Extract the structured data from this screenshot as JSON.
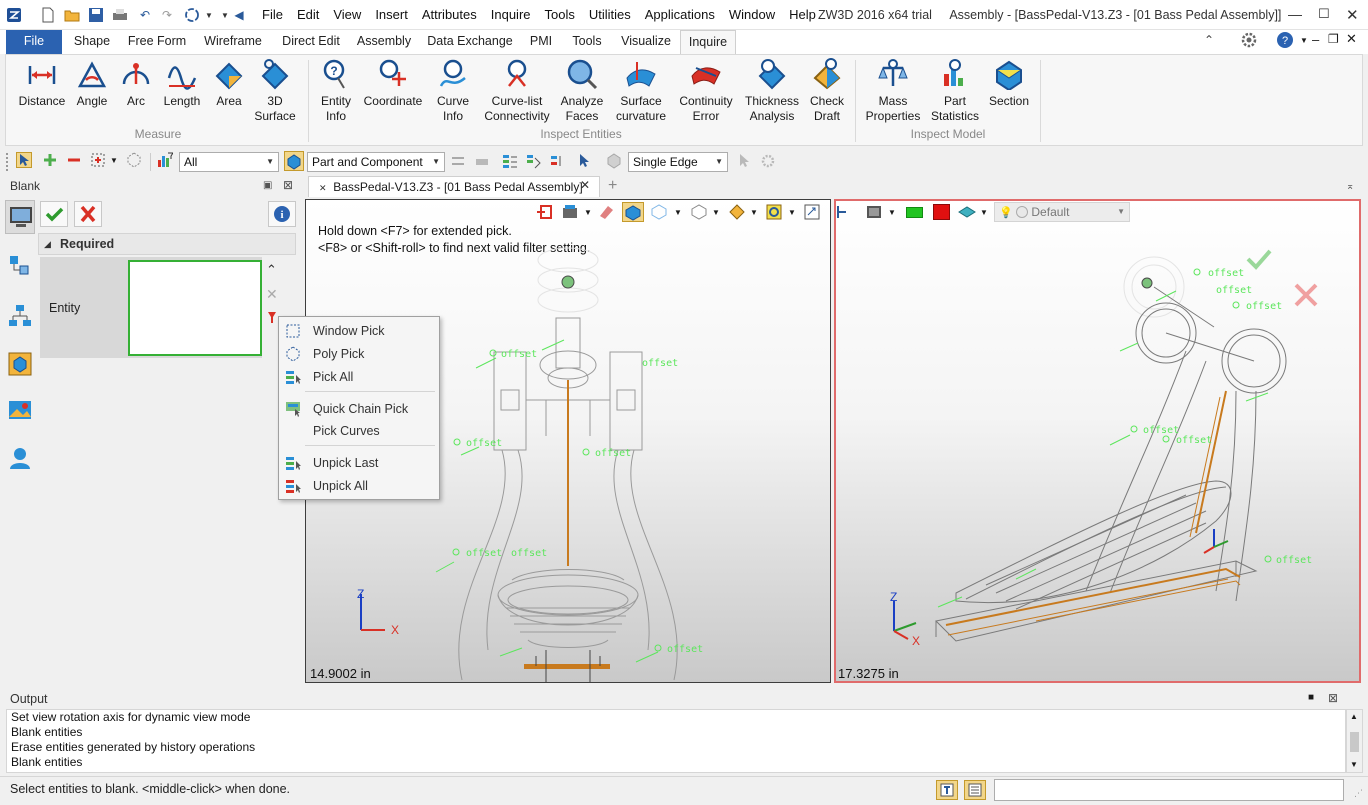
{
  "title_bar": {
    "menus": [
      "File",
      "Edit",
      "View",
      "Insert",
      "Attributes",
      "Inquire",
      "Tools",
      "Utilities",
      "Applications",
      "Window",
      "Help"
    ],
    "app_title": "ZW3D 2016  x64 trial",
    "doc_title": "Assembly - [BassPedal-V13.Z3 - [01 Bass Pedal Assembly]]"
  },
  "ribbon_tabs": [
    "File",
    "Shape",
    "Free Form",
    "Wireframe",
    "Direct Edit",
    "Assembly",
    "Data Exchange",
    "PMI",
    "Tools",
    "Visualize",
    "Inquire"
  ],
  "active_tab": "Inquire",
  "ribbon_groups": [
    {
      "name": "Measure",
      "buttons": [
        {
          "label": "Distance",
          "icon": "distance-icon"
        },
        {
          "label": "Angle",
          "icon": "angle-icon"
        },
        {
          "label": "Arc",
          "icon": "arc-icon"
        },
        {
          "label": "Length",
          "icon": "length-icon"
        },
        {
          "label": "Area",
          "icon": "area-icon"
        },
        {
          "label": "3D Surface",
          "icon": "3d-surface-icon"
        }
      ]
    },
    {
      "name": "Inspect Entities",
      "buttons": [
        {
          "label": "Entity Info",
          "icon": "entity-info-icon"
        },
        {
          "label": "Coordinate",
          "icon": "coordinate-icon"
        },
        {
          "label": "Curve Info",
          "icon": "curve-info-icon"
        },
        {
          "label": "Curve-list Connectivity",
          "icon": "curve-list-connectivity-icon"
        },
        {
          "label": "Analyze Faces",
          "icon": "analyze-faces-icon"
        },
        {
          "label": "Surface curvature",
          "icon": "surface-curvature-icon"
        },
        {
          "label": "Continuity Error",
          "icon": "continuity-error-icon"
        },
        {
          "label": "Thickness Analysis",
          "icon": "thickness-analysis-icon"
        },
        {
          "label": "Check Draft",
          "icon": "check-draft-icon"
        }
      ]
    },
    {
      "name": "Inspect Model",
      "buttons": [
        {
          "label": "Mass Properties",
          "icon": "mass-properties-icon"
        },
        {
          "label": "Part Statistics",
          "icon": "part-statistics-icon"
        },
        {
          "label": "Section",
          "icon": "section-icon"
        }
      ]
    }
  ],
  "filter_bar": {
    "filter_all": "All",
    "pick_scope": "Part and Component",
    "edge_mode": "Single Edge"
  },
  "panel": {
    "title": "Blank",
    "section": "Required",
    "field_label": "Entity"
  },
  "context_menu": [
    {
      "label": "Window Pick",
      "icon": "window-pick-icon"
    },
    {
      "label": "Poly Pick",
      "icon": "poly-pick-icon"
    },
    {
      "label": "Pick All",
      "icon": "pick-all-icon"
    },
    {
      "label": "Quick Chain Pick",
      "icon": "quick-chain-pick-icon"
    },
    {
      "label": "Pick Curves",
      "icon": "pick-curves-icon"
    },
    {
      "label": "Unpick Last",
      "icon": "unpick-last-icon"
    },
    {
      "label": "Unpick All",
      "icon": "unpick-all-icon"
    }
  ],
  "document_tab": "BassPedal-V13.Z3 - [01 Bass Pedal Assembly]",
  "viewport_left": {
    "hint_line1": "Hold down <F7> for extended pick.",
    "hint_line2": "<F8> or <Shift-roll> to find next valid filter setting.",
    "scale": "14.9002 in"
  },
  "viewport_right": {
    "render_style": "Default",
    "scale": "17.3275 in"
  },
  "annotations": {
    "offset": "offset",
    "axis_x": "X",
    "axis_z": "Z"
  },
  "output": {
    "title": "Output",
    "lines": [
      "Set view rotation axis for dynamic view mode",
      "Blank entities",
      "Erase entities generated by history operations",
      "Blank entities"
    ]
  },
  "status": {
    "message": "Select entities to blank.  <middle-click> when done."
  },
  "colors": {
    "accent": "#2b62b1",
    "selection_red": "#e06b6b",
    "offset_green": "#5ce65c",
    "wire_orange": "#c87a1e"
  }
}
